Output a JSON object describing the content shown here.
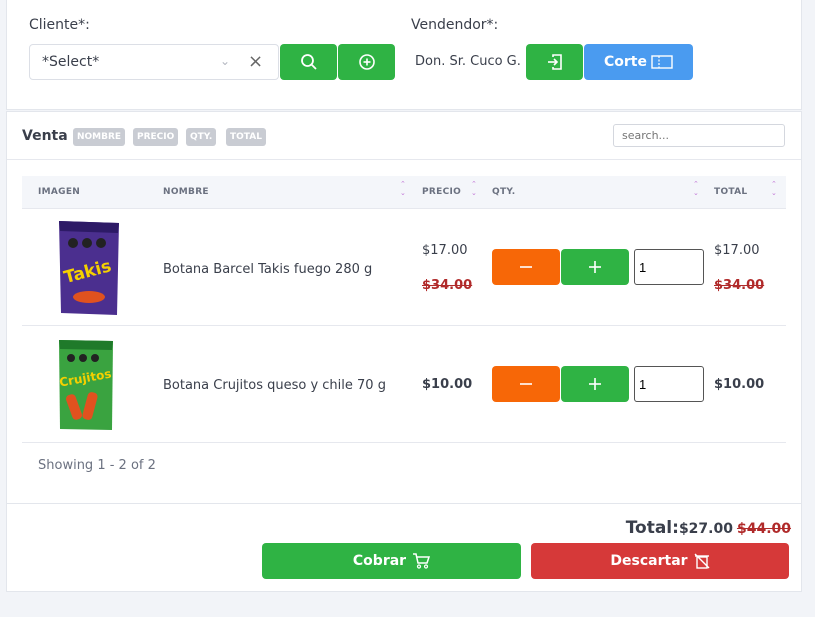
{
  "header": {
    "cliente_label": "Cliente*:",
    "cliente_value": "*Select*",
    "vendedor_label": "Vendendor*:",
    "vendedor_value": "Don. Sr. Cuco G.",
    "corte_label": "Corte"
  },
  "venta": {
    "title": "Venta",
    "chips": [
      "NOMBRE",
      "PRECIO",
      "QTY.",
      "TOTAL"
    ],
    "search_placeholder": "search..."
  },
  "table": {
    "columns": [
      "IMAGEN",
      "NOMBRE",
      "PRECIO",
      "QTY.",
      "TOTAL"
    ],
    "rows": [
      {
        "name": "Botana Barcel Takis fuego 280 g",
        "price": "$17.00",
        "old_price": "$34.00",
        "qty": "1",
        "total": "$17.00",
        "old_total": "$34.00",
        "image_text": "Takis",
        "image_color": "#4b2f8f"
      },
      {
        "name": "Botana Crujitos queso y chile 70 g",
        "price": "$10.00",
        "old_price": "",
        "qty": "1",
        "total": "$10.00",
        "old_total": "",
        "image_text": "Crujitos",
        "image_color": "#3aa340"
      }
    ],
    "showing": "Showing 1 - 2 of 2"
  },
  "footer": {
    "total_label": "Total:",
    "total_value": "$27.00",
    "total_old": "$44.00",
    "cobrar_label": "Cobrar",
    "descartar_label": "Descartar"
  },
  "colors": {
    "green": "#2fb344",
    "blue": "#4a9bf0",
    "orange": "#f76707",
    "red": "#d63939"
  }
}
